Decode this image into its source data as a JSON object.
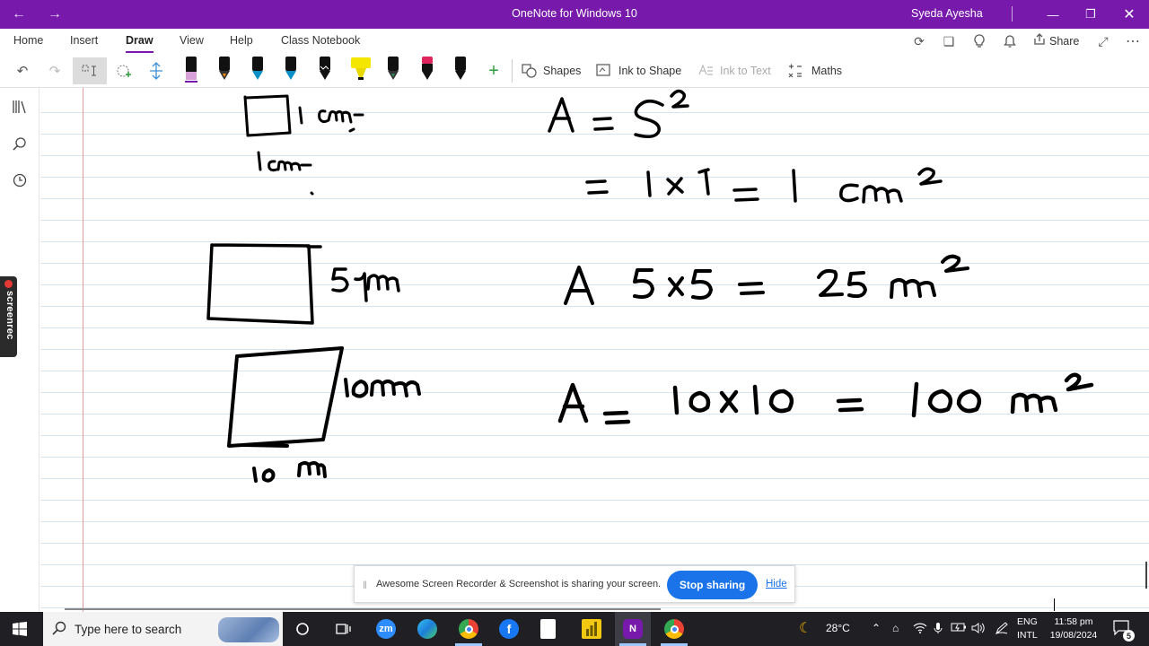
{
  "window": {
    "title": "OneNote for Windows 10",
    "user": "Syeda Ayesha"
  },
  "menu": {
    "tabs": [
      "Home",
      "Insert",
      "Draw",
      "View",
      "Help",
      "Class Notebook"
    ],
    "active_tab": "Draw",
    "share_label": "Share"
  },
  "toolbar": {
    "shapes_label": "Shapes",
    "ink_to_shape_label": "Ink to Shape",
    "ink_to_text_label": "Ink to Text",
    "maths_label": "Maths",
    "pens": [
      {
        "color": "#000000",
        "tip": "#d8a0d8"
      },
      {
        "color": "#000000",
        "tip": "#ff8c00"
      },
      {
        "color": "#0a8fc7",
        "tip": "#0a8fc7"
      },
      {
        "color": "#0a8fc7",
        "tip": "#0a8fc7"
      },
      {
        "color": "#000000",
        "tip": "#000000"
      },
      {
        "color": "#f5e600",
        "tip": "#f5e600"
      },
      {
        "color": "#000000",
        "tip": "#2e8b57"
      },
      {
        "color": "#e0245e",
        "tip": "#e0245e"
      },
      {
        "color": "#000000",
        "tip": "#000000"
      }
    ]
  },
  "screenrec_label": "screenrec",
  "banner": {
    "message": "Awesome Screen Recorder & Screenshot is sharing your screen.",
    "stop_label": "Stop sharing",
    "hide_label": "Hide"
  },
  "taskbar": {
    "search_placeholder": "Type here to search",
    "temperature": "28°C",
    "lang_top": "ENG",
    "lang_bottom": "INTL",
    "time": "11:58 pm",
    "date": "19/08/2024",
    "notification_count": "5"
  },
  "colors": {
    "titlebar": "#7719aa",
    "accent": "#7719aa",
    "stop_button": "#1a73e8"
  }
}
